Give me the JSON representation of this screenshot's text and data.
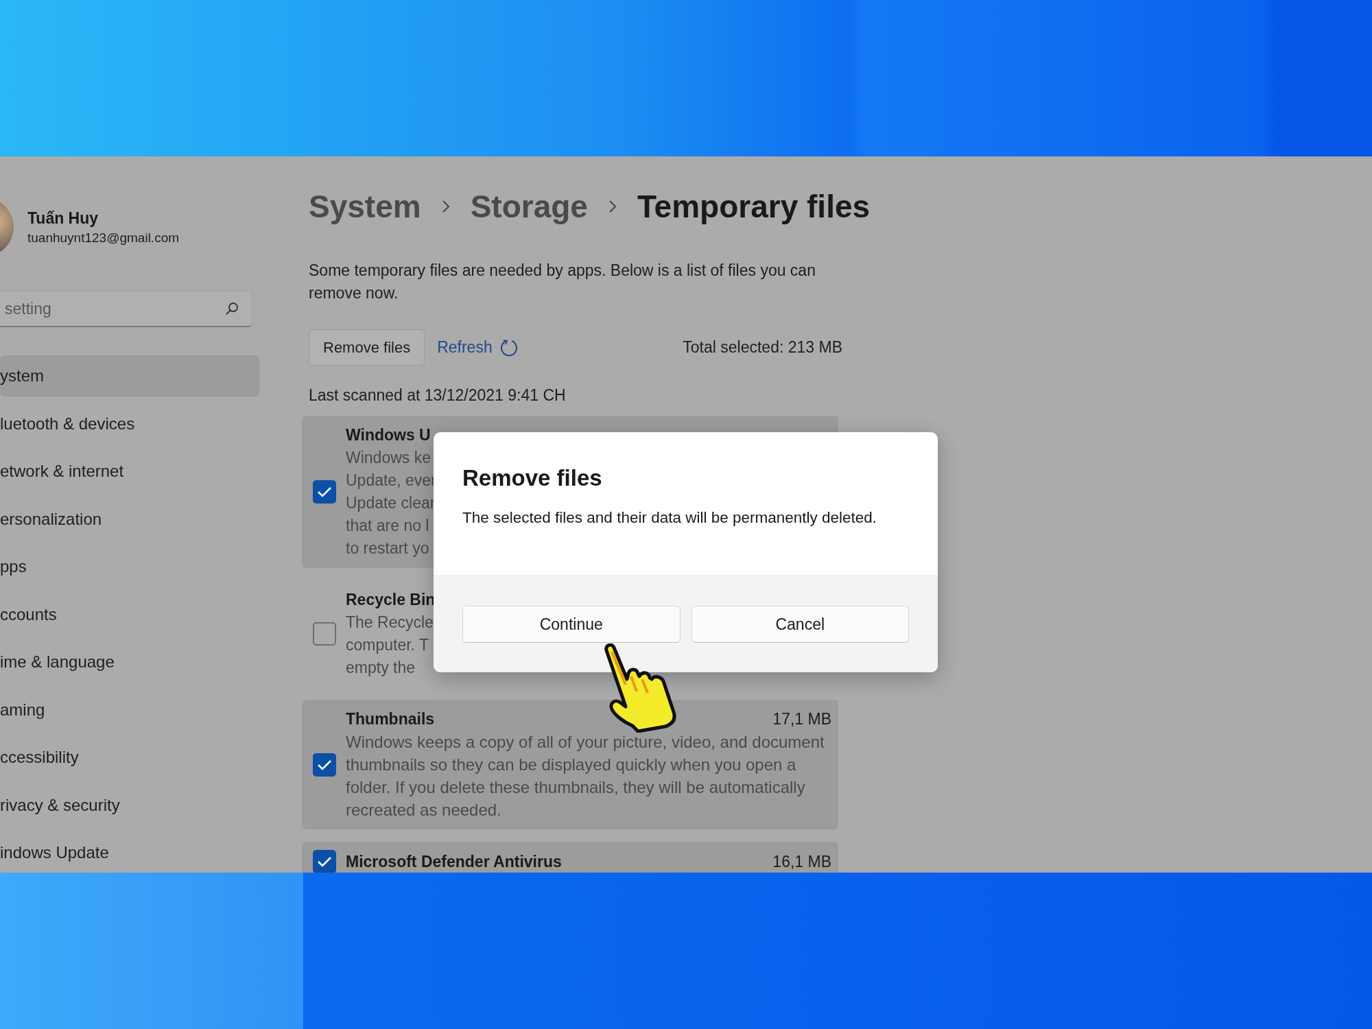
{
  "account": {
    "name": "Tuấn Huy",
    "email": "tuanhuynt123@gmail.com"
  },
  "search": {
    "placeholder": "setting"
  },
  "nav": [
    {
      "label": "ystem",
      "selected": true
    },
    {
      "label": "luetooth & devices",
      "selected": false
    },
    {
      "label": "etwork & internet",
      "selected": false
    },
    {
      "label": "ersonalization",
      "selected": false
    },
    {
      "label": "pps",
      "selected": false
    },
    {
      "label": "ccounts",
      "selected": false
    },
    {
      "label": "ime & language",
      "selected": false
    },
    {
      "label": "aming",
      "selected": false
    },
    {
      "label": "ccessibility",
      "selected": false
    },
    {
      "label": "rivacy & security",
      "selected": false
    },
    {
      "label": "indows Update",
      "selected": false
    }
  ],
  "breadcrumb": [
    "System",
    "Storage",
    "Temporary files"
  ],
  "description": "Some temporary files are needed by apps. Below is a list of files you can remove now.",
  "actions": {
    "remove": "Remove files",
    "refresh": "Refresh",
    "total": "Total selected: 213 MB"
  },
  "last_scanned": "Last scanned at 13/12/2021 9:41 CH",
  "categories": [
    {
      "title": "Windows U",
      "lines": [
        "Windows ke",
        "Update, ever",
        "Update clear",
        "that are no l",
        "to restart yo"
      ],
      "checked": true,
      "highlighted": true
    },
    {
      "title": "Recycle Bin",
      "lines": [
        "The Recycle",
        "computer. T",
        "empty the"
      ],
      "checked": false,
      "highlighted": false
    },
    {
      "title": "Thumbnails",
      "size": "17,1 MB",
      "description": "Windows keeps a copy of all of your picture, video, and document thumbnails so they can be displayed quickly when you open a folder. If you delete these thumbnails, they will be automatically recreated as needed.",
      "checked": true,
      "highlighted": true
    },
    {
      "title": "Microsoft Defender Antivirus",
      "size": "16,1 MB",
      "checked": true,
      "highlighted": true
    }
  ],
  "dialog": {
    "title": "Remove files",
    "message": "The selected files and their data will be permanently deleted.",
    "buttons": [
      {
        "label": "Continue"
      },
      {
        "label": "Cancel"
      }
    ]
  }
}
